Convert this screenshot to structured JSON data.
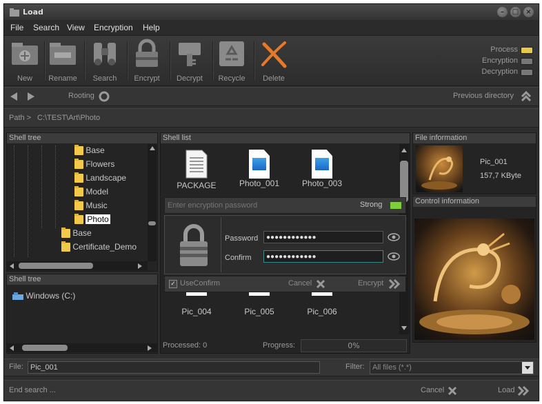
{
  "window": {
    "title": "Load"
  },
  "menu": [
    "File",
    "Search",
    "View",
    "Encryption",
    "Help"
  ],
  "toolbar": {
    "buttons": [
      "New",
      "Rename",
      "Search",
      "Encrypt",
      "Decrypt",
      "Recycle",
      "Delete"
    ],
    "indicators": [
      "Process",
      "Encryption",
      "Decryption"
    ]
  },
  "nav": {
    "rooting": "Rooting",
    "previous": "Previous directory"
  },
  "path": {
    "label": "Path >",
    "value": "C:\\TEST\\Art\\Photo"
  },
  "shell_tree": {
    "title": "Shell tree",
    "items": [
      "Base",
      "Flowers",
      "Landscape",
      "Model",
      "Music",
      "Photo",
      "Base",
      "Certificate_Demo"
    ],
    "selected": "Photo"
  },
  "shell_tree2": {
    "title": "Shell tree",
    "drive": "Windows (C:)"
  },
  "shell_list": {
    "title": "Shell list",
    "files_top": [
      "PACKAGE",
      "Photo_001",
      "Photo_003"
    ],
    "files_bottom": [
      "Pic_004",
      "Pic_005",
      "Pic_006"
    ],
    "processed": "Processed: 0",
    "progress_label": "Progress:",
    "progress_value": "0%"
  },
  "encrypt_dialog": {
    "placeholder": "Enter encryption password",
    "strength": "Strong",
    "password_label": "Password",
    "password_value": "●●●●●●●●●●●●",
    "confirm_label": "Confirm",
    "confirm_value": "●●●●●●●●●●●●",
    "use_confirm": "UseConfirm",
    "cancel": "Cancel",
    "encrypt": "Encrypt"
  },
  "file_info": {
    "title": "File information",
    "name": "Pic_001",
    "size": "157,7 KByte"
  },
  "control_info": {
    "title": "Control information"
  },
  "bottom": {
    "file_label": "File:",
    "file_value": "Pic_001",
    "filter_label": "Filter:",
    "filter_value": "All files (*.*)",
    "status": "End search ...",
    "cancel": "Cancel",
    "load": "Load"
  },
  "colors": {
    "accent": "#e8792a",
    "indicator_on": "#e6c84a",
    "strong": "#7fcf3a"
  }
}
